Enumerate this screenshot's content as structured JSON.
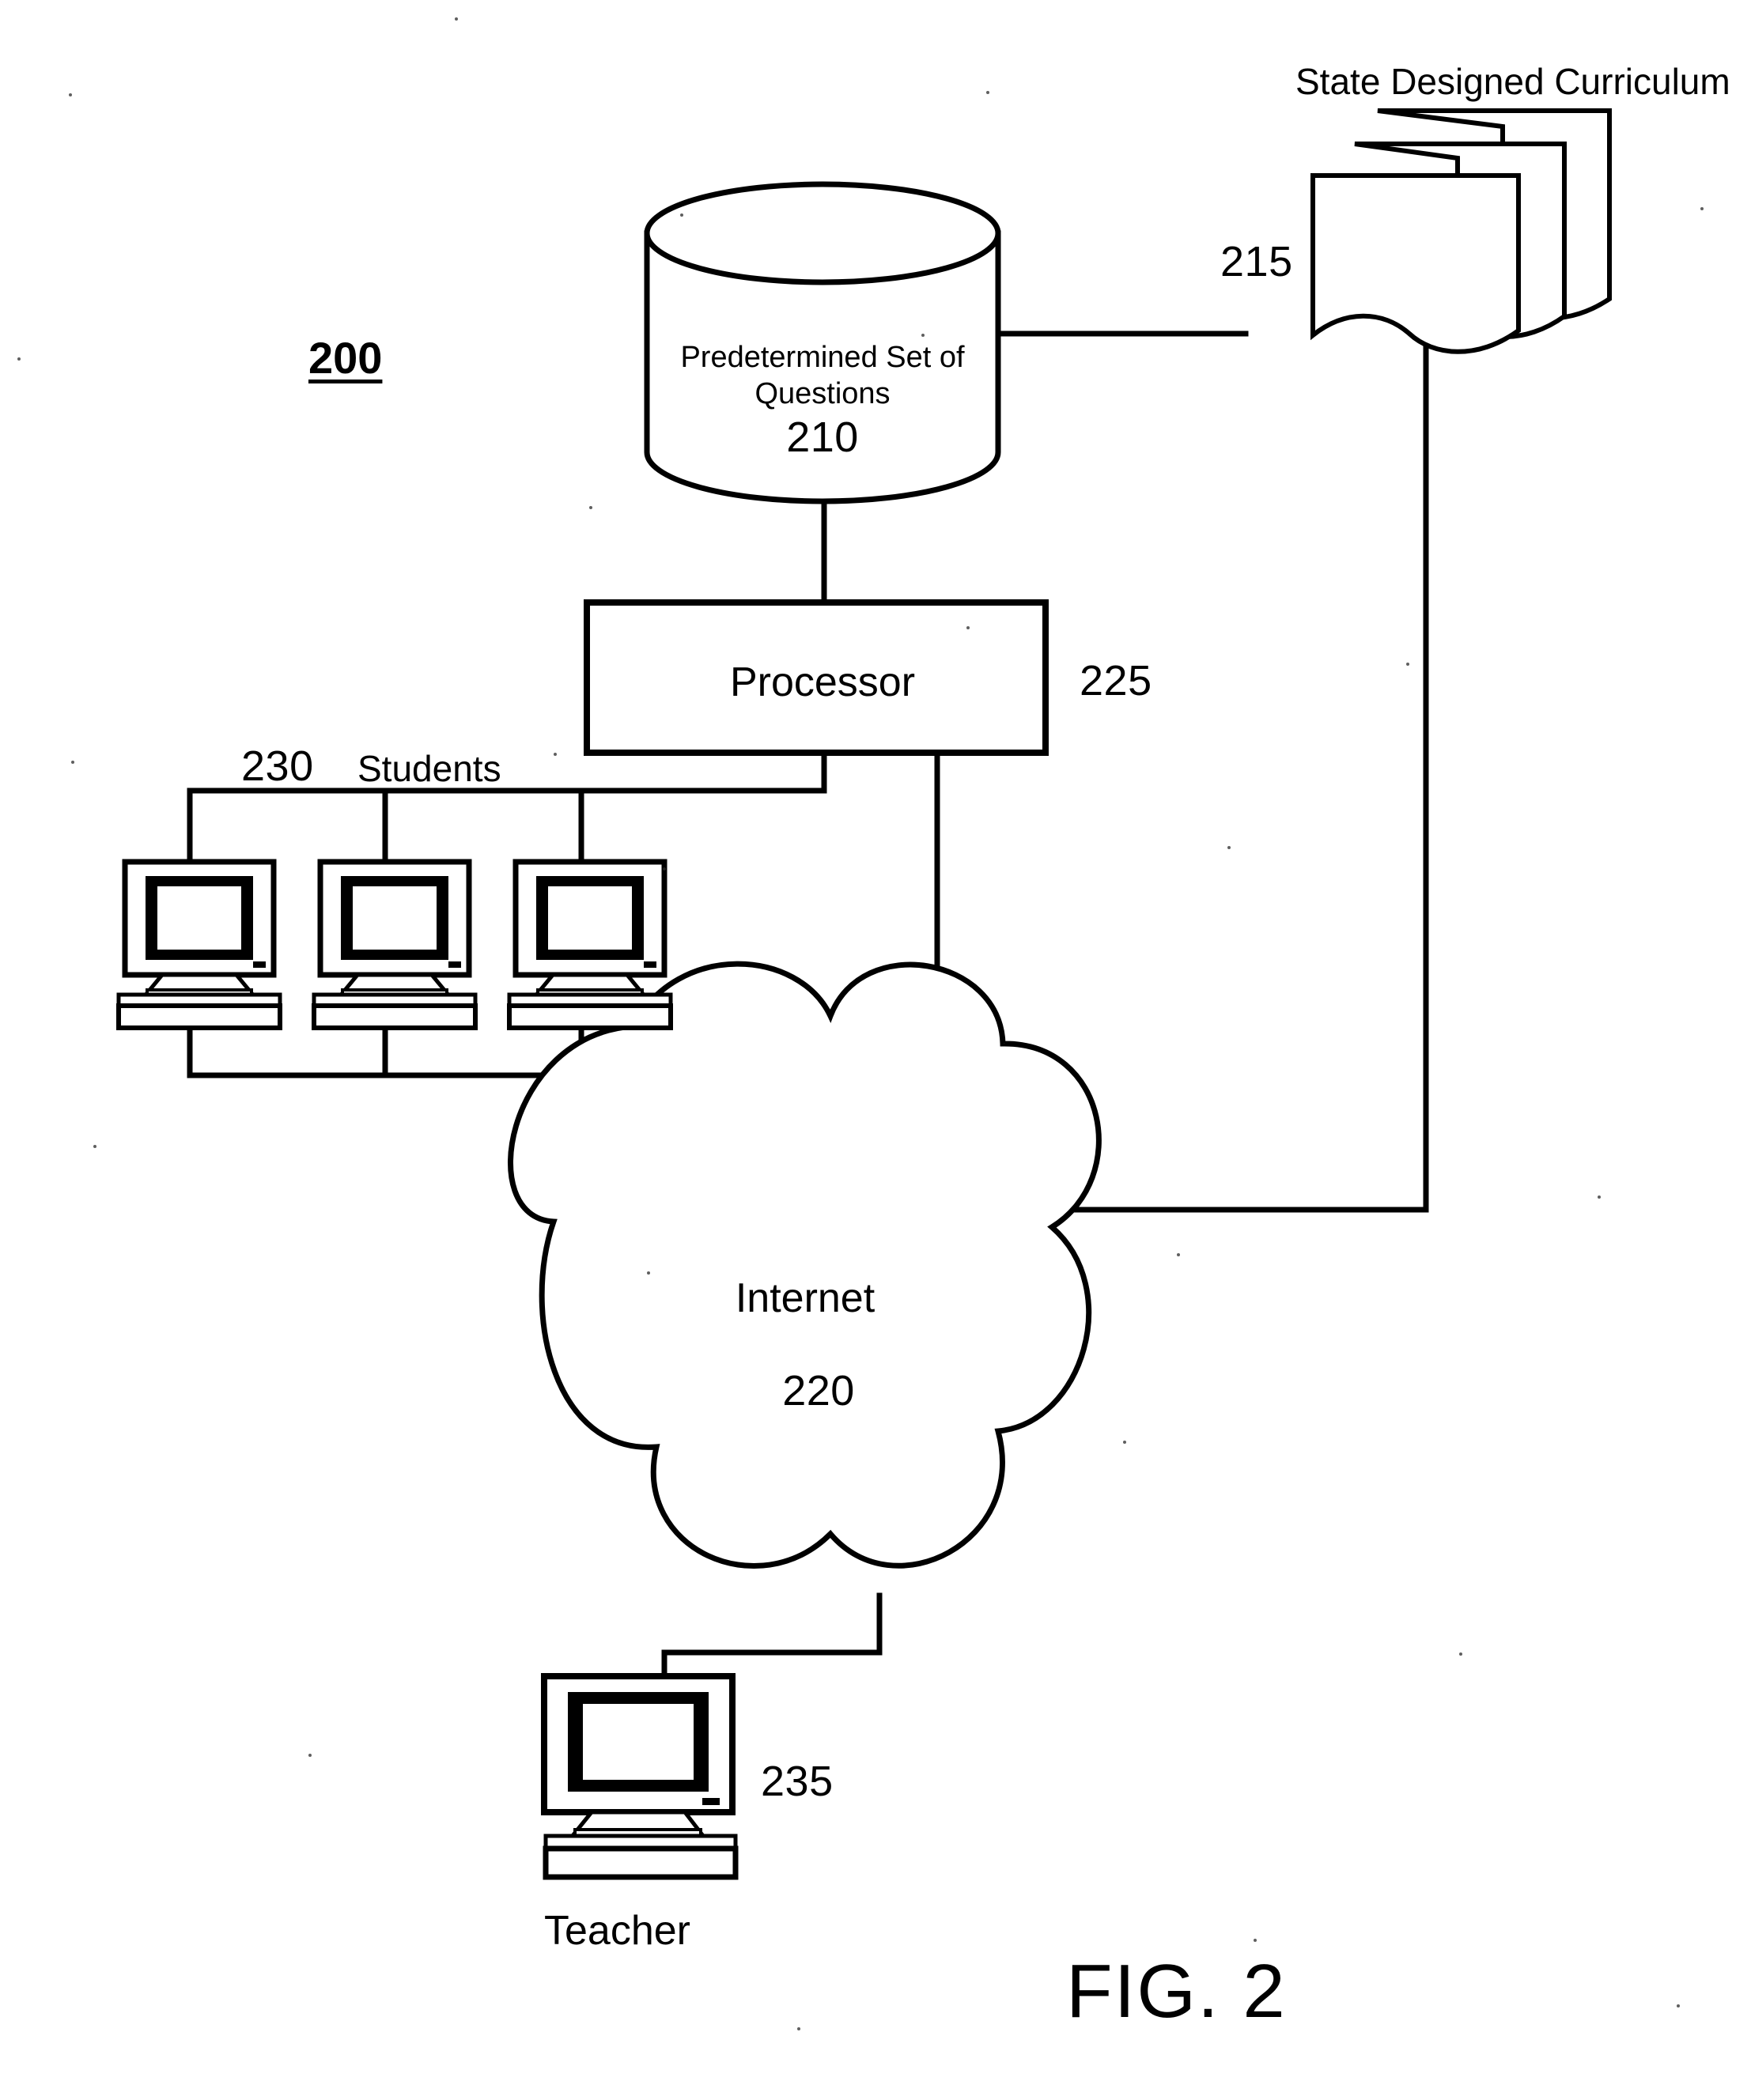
{
  "figure": {
    "caption": "FIG. 2",
    "system_ref": "200"
  },
  "nodes": {
    "database": {
      "label_line1": "Predetermined Set of",
      "label_line2": "Questions",
      "ref": "210",
      "icon": "cylinder-database-icon"
    },
    "curriculum": {
      "title": "State Designed Curriculum",
      "ref": "215",
      "icon": "document-stack-icon"
    },
    "processor": {
      "label": "Processor",
      "ref": "225",
      "icon": "rectangle-box-icon"
    },
    "internet": {
      "label": "Internet",
      "ref": "220",
      "icon": "cloud-icon"
    },
    "students": {
      "label": "Students",
      "ref": "230",
      "icon": "desktop-computer-icon",
      "count": 3
    },
    "teacher": {
      "label": "Teacher",
      "ref": "235",
      "icon": "desktop-computer-icon"
    }
  },
  "colors": {
    "stroke": "#000000",
    "background": "#ffffff",
    "screen_bezel": "#000000"
  }
}
